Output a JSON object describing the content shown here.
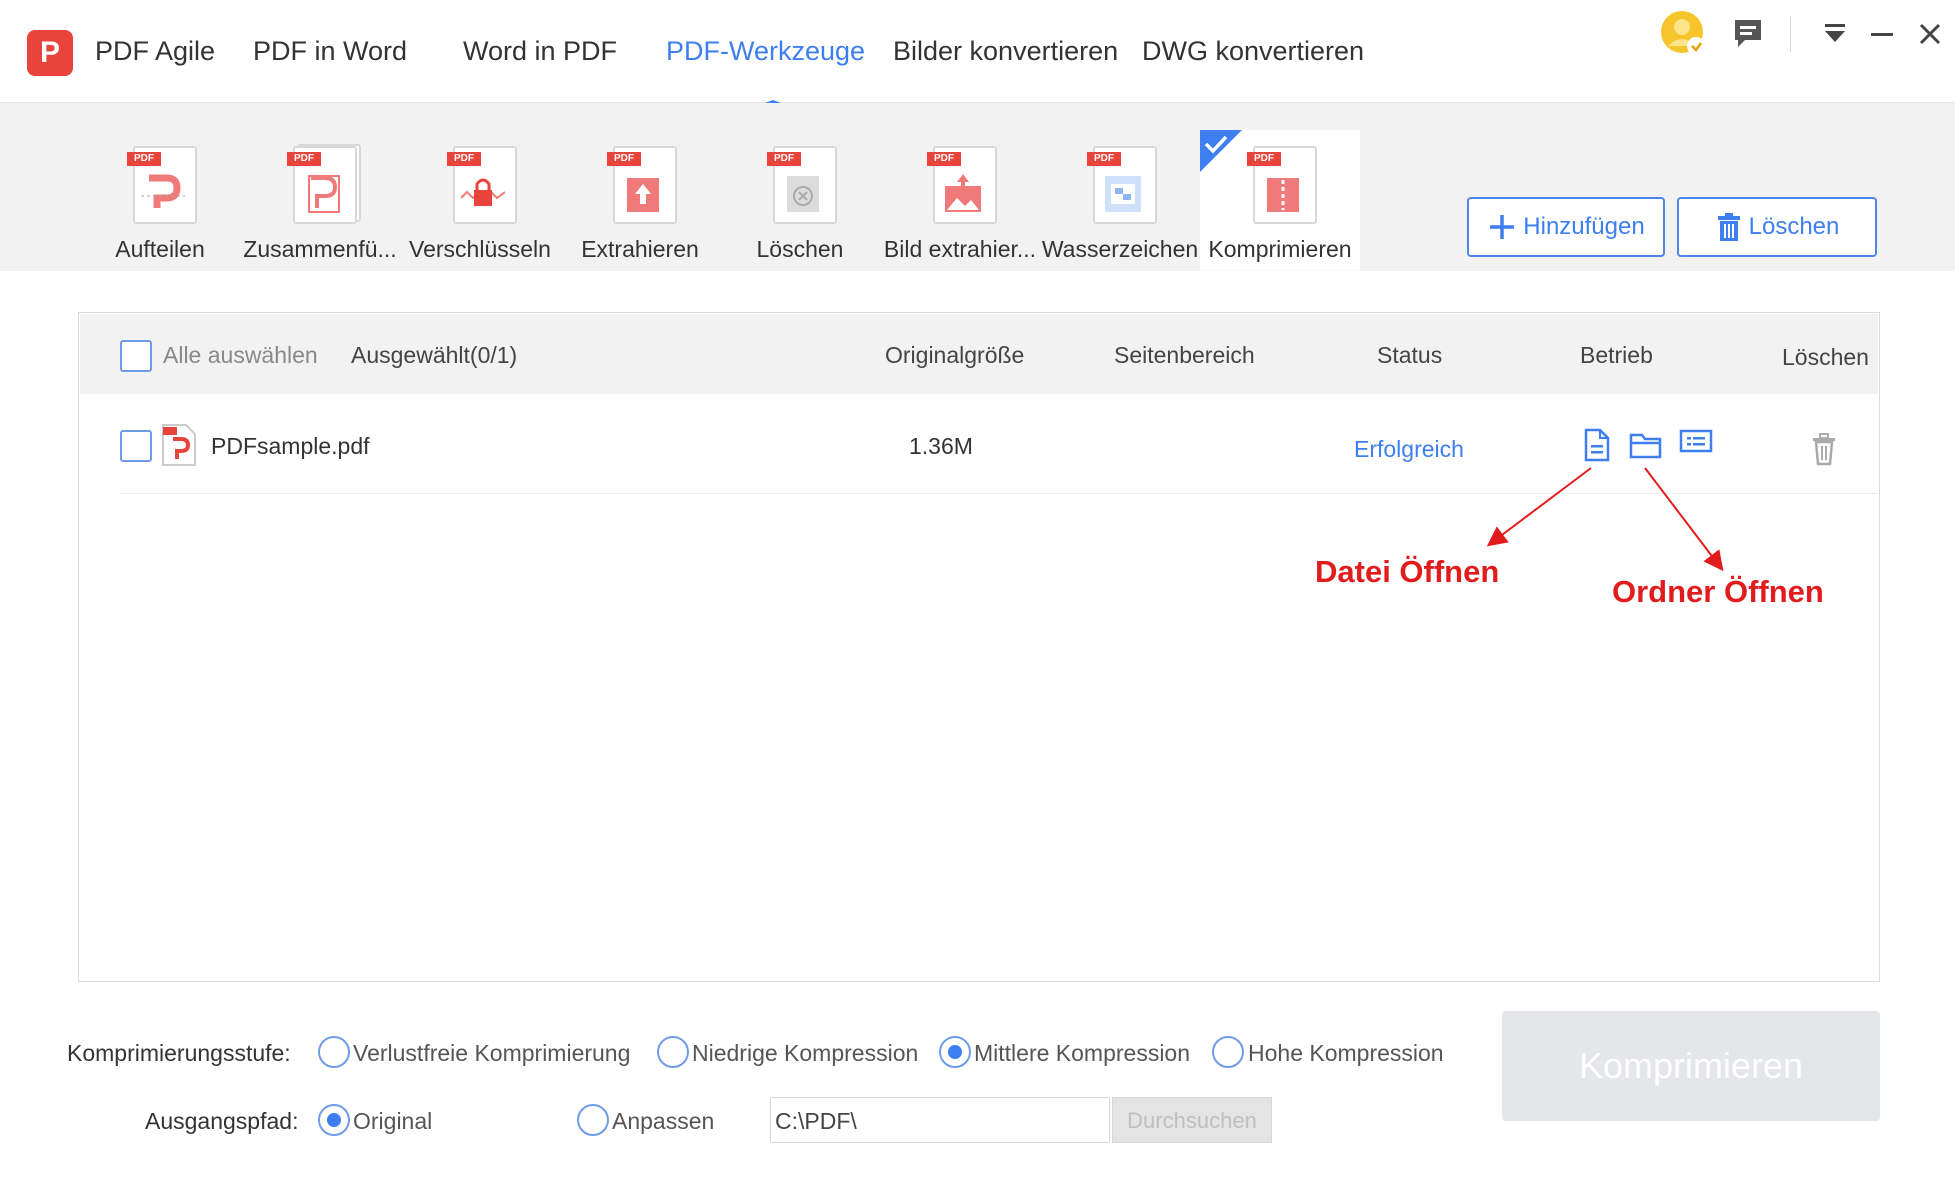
{
  "app": {
    "logo_letter": "P",
    "tabs": [
      "PDF Agile",
      "PDF in Word",
      "Word in PDF",
      "PDF-Werkzeuge",
      "Bilder konvertieren",
      "DWG konvertieren"
    ],
    "active_tab": "PDF-Werkzeuge",
    "accent_color": "#3d7ef0",
    "brand_color": "#e8443b"
  },
  "tools": {
    "items": [
      "Aufteilen",
      "Zusammenfü...",
      "Verschlüsseln",
      "Extrahieren",
      "Löschen",
      "Bild extrahier...",
      "Wasserzeichen",
      "Komprimieren"
    ],
    "active": "Komprimieren",
    "pdf_tag": "PDF",
    "add_label": "Hinzufügen",
    "delete_label": "Löschen"
  },
  "table": {
    "select_all": "Alle auswählen",
    "selected_count": "Ausgewählt(0/1)",
    "headers": {
      "size": "Originalgröße",
      "range": "Seitenbereich",
      "status": "Status",
      "operation": "Betrieb",
      "delete": "Löschen"
    },
    "rows": [
      {
        "name": "PDFsample.pdf",
        "size": "1.36M",
        "status": "Erfolgreich"
      }
    ],
    "status_color": "#3d7ef0"
  },
  "annotations": {
    "open_file": "Datei Öffnen",
    "open_folder": "Ordner Öffnen",
    "color": "#e21c1c"
  },
  "options": {
    "level_label": "Komprimierungsstufe:",
    "levels": [
      "Verlustfreie Komprimierung",
      "Niedrige Kompression",
      "Mittlere Kompression",
      "Hohe Kompression"
    ],
    "selected_level": "Mittlere Kompression",
    "output_label": "Ausgangspfad:",
    "outputs": [
      "Original",
      "Anpassen"
    ],
    "selected_output": "Original",
    "path_value": "C:\\PDF\\",
    "browse_label": "Durchsuchen",
    "compress_label": "Komprimieren"
  }
}
